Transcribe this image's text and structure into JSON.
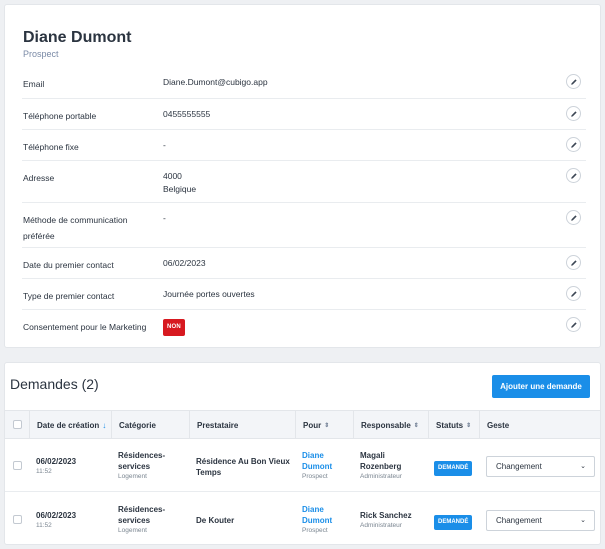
{
  "contact": {
    "name": "Diane Dumont",
    "status": "Prospect",
    "fields": [
      {
        "label": "Email",
        "value": "Diane.Dumont@cubigo.app"
      },
      {
        "label": "Téléphone portable",
        "value": "0455555555"
      },
      {
        "label": "Téléphone fixe",
        "value": "-"
      },
      {
        "label": "Adresse",
        "value_line1": "4000",
        "value_line2": "Belgique"
      },
      {
        "label": "Méthode de communication préférée",
        "value": "-"
      },
      {
        "label": "Date du premier contact",
        "value": "06/02/2023"
      },
      {
        "label": "Type de premier contact",
        "value": "Journée portes ouvertes"
      },
      {
        "label": "Consentement pour le Marketing",
        "badge": "NON"
      }
    ],
    "edit_icon": "pencil-icon"
  },
  "requests": {
    "title": "Demandes (2)",
    "add_button": "Ajouter une demande",
    "columns": [
      "Date de création",
      "Catégorie",
      "Prestataire",
      "Pour",
      "Responsable",
      "Statuts",
      "Geste"
    ],
    "sort_icons": {
      "active": "↓",
      "inactive": "⇕"
    },
    "rows": [
      {
        "date": "06/02/2023",
        "time": "11:52",
        "category": "Résidences-services",
        "category_sub": "Logement",
        "provider": "Résidence Au Bon Vieux Temps",
        "for_name": "Diane Dumont",
        "for_sub": "Prospect",
        "responsible": "Magali Rozenberg",
        "responsible_sub": "Administrateur",
        "status": "DEMANDÉ",
        "action": "Changement"
      },
      {
        "date": "06/02/2023",
        "time": "11:52",
        "category": "Résidences-services",
        "category_sub": "Logement",
        "provider": "De Kouter",
        "for_name": "Diane Dumont",
        "for_sub": "Prospect",
        "responsible": "Rick Sanchez",
        "responsible_sub": "Administrateur",
        "status": "DEMANDÉ",
        "action": "Changement"
      }
    ]
  },
  "colors": {
    "accent": "#1a8ee8",
    "danger": "#d71920",
    "text": "#2b3440",
    "muted": "#7a8aa6"
  }
}
